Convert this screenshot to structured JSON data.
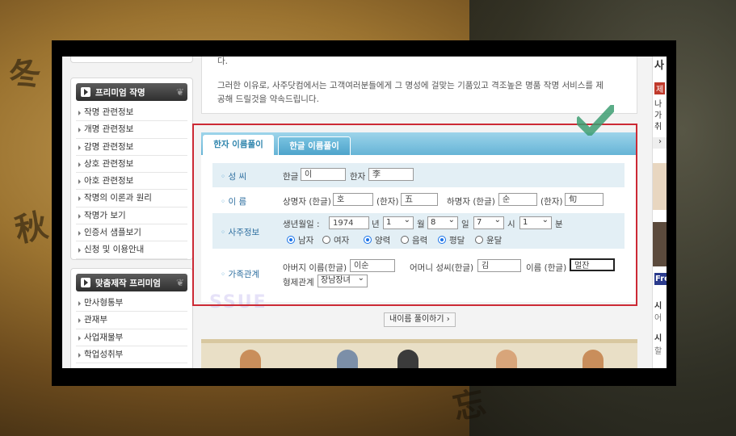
{
  "premium_naming": {
    "title": "프리미엄 작명",
    "items": [
      "작명 관련정보",
      "개명 관련정보",
      "감명 관련정보",
      "상호 관련정보",
      "아호 관련정보",
      "작명의 이론과 원리",
      "작명가 보기",
      "인증서 샘플보기",
      "신청 및 이용안내"
    ]
  },
  "custom_premium": {
    "title": "맞춤제작 프리미엄",
    "items": [
      "만사형통부",
      "관재부",
      "사업재물부",
      "학업성취부"
    ]
  },
  "intro": {
    "line0": "다.",
    "line1": "그러한 이유로, 사주닷컴에서는 고객여러분들에게 그 명성에 걸맞는 기품있고 격조높은 명품 작명 서비스를 제",
    "line2": "공해 드릴것을 약속드립니다."
  },
  "tabs": {
    "active": "한자 이름풀이",
    "inactive": "한글 이름풀이"
  },
  "form": {
    "surname": {
      "label": "성 씨",
      "hangul_label": "한글",
      "hangul_value": "이",
      "hanja_label": "한자",
      "hanja_value": "李"
    },
    "name": {
      "label": "이 름",
      "upper_label": "상명자 (한글)",
      "upper_value": "호",
      "upper_hanja_label": "(한자)",
      "upper_hanja_value": "五",
      "lower_label": "하명자 (한글)",
      "lower_value": "순",
      "lower_hanja_label": "(한자)",
      "lower_hanja_value": "旬"
    },
    "saju": {
      "label": "사주정보",
      "birth_label": "생년월일 :",
      "year_value": "1974",
      "year_unit": "년",
      "month_value": "1",
      "month_unit": "월",
      "day_value": "8",
      "day_unit": "일",
      "hour_value": "7",
      "hour_unit": "시",
      "minute_value": "1",
      "minute_unit": "분",
      "gender": {
        "male": "남자",
        "female": "여자",
        "selected": "male"
      },
      "calendar": {
        "solar": "양력",
        "lunar": "음력",
        "selected": "solar"
      },
      "month_type": {
        "normal": "평달",
        "leap": "윤달",
        "selected": "normal"
      }
    },
    "family": {
      "label": "가족관계",
      "father_label": "아버지 이름(한글)",
      "father_value": "이순",
      "mother_label": "어머니 성씨(한글)",
      "mother_value": "김",
      "own_label": "이름 (한글)",
      "own_value": "멀잔",
      "sibling_label": "형제관계",
      "sibling_value": "장남장녀"
    }
  },
  "submit_button": "내이름 풀이하기 ›",
  "right_column": [
    "사",
    "제",
    "나",
    "가",
    "취",
    "시",
    "어",
    "시",
    "할",
    "Free"
  ],
  "colors": {
    "tab_blue": "#66b4d6",
    "highlight_red": "#cc2a35",
    "check_green": "#3d9e72"
  }
}
